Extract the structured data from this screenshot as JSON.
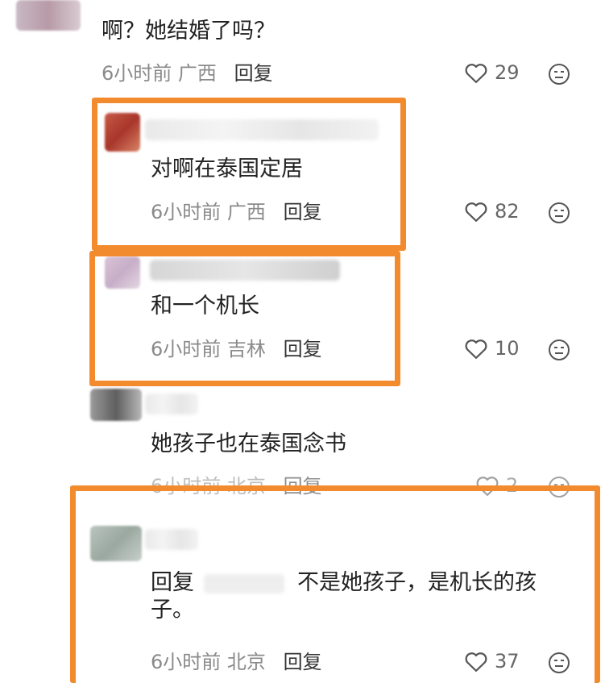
{
  "comments": [
    {
      "text": "啊？她结婚了吗？",
      "time": "6小时前",
      "location": "广西",
      "reply": "回复",
      "likes": "29"
    },
    {
      "text": "对啊在泰国定居",
      "time": "6小时前",
      "location": "广西",
      "reply": "回复",
      "likes": "82"
    },
    {
      "text": "和一个机长",
      "time": "6小时前",
      "location": "吉林",
      "reply": "回复",
      "likes": "10"
    },
    {
      "text": "她孩子也在泰国念书",
      "time": "6小时前",
      "location": "北京",
      "reply": "回复",
      "likes": "2"
    },
    {
      "reply_prefix": "回复",
      "text_line1": "不是她孩子，是机长的孩",
      "text_line2": "子。",
      "time": "6小时前",
      "location": "北京",
      "reply": "回复",
      "likes": "37"
    }
  ],
  "colors": {
    "highlight": "#f28a2e",
    "meta": "#8a8a8a"
  }
}
